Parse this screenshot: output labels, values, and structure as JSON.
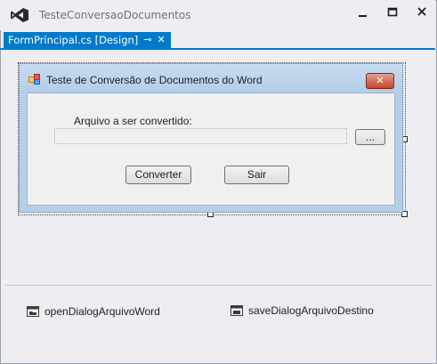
{
  "app": {
    "title": "TesteConversaoDocumentos",
    "icon": "visual-studio-logo"
  },
  "window_controls": [
    "minimize-icon",
    "maximize-icon",
    "close-icon"
  ],
  "tabs": [
    {
      "label": "FormPrincipal.cs [Design]",
      "active": true,
      "pin_glyph": "⊸",
      "close_glyph": "✕"
    }
  ],
  "accent_color": "#007acc",
  "form": {
    "title": "Teste de Conversão de Documentos do Word",
    "close_glyph": "✕",
    "label_arquivo": "Arquivo a ser convertido:",
    "textbox_value": "",
    "browse_label": "...",
    "converter_label": "Converter",
    "sair_label": "Sair"
  },
  "tray": {
    "items": [
      {
        "label": "openDialogArquivoWord",
        "icon": "open-file-dialog-icon"
      },
      {
        "label": "saveDialogArquivoDestino",
        "icon": "save-file-dialog-icon"
      }
    ]
  }
}
